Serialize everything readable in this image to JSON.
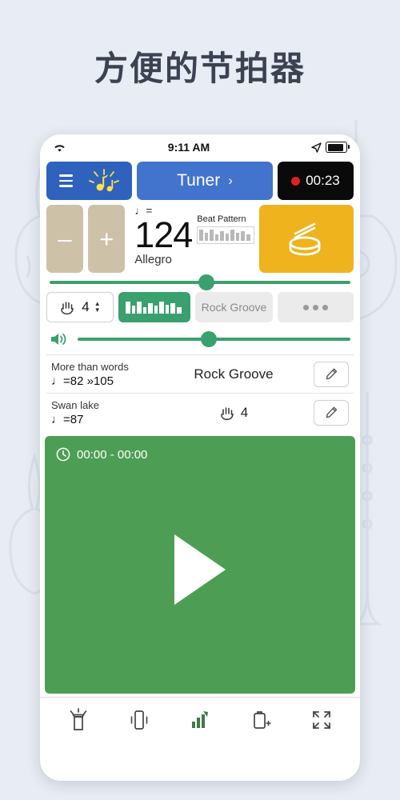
{
  "headline": "方便的节拍器",
  "status_bar": {
    "wifi_icon": "wifi-icon",
    "time": "9:11 AM",
    "location_icon": "location-arrow-icon",
    "battery_icon": "battery-full-icon"
  },
  "top_row": {
    "menu_button": {
      "name": "menu-button",
      "icon": "hamburger-icon",
      "secondary_icon": "metronome-icon"
    },
    "tuner_button": {
      "label": "Tuner",
      "chevron": "›"
    },
    "record_button": {
      "label": "00:23",
      "dot": "record-dot-icon"
    }
  },
  "tempo": {
    "minus_label": "–",
    "plus_label": "+",
    "note_eq": "♩=",
    "bpm": "124",
    "tempo_word": "Allegro",
    "beat_pattern_label": "Beat Pattern",
    "drum_icon": "drum-icon"
  },
  "tempo_slider": {
    "value_percent": 52
  },
  "volume_slider": {
    "icon": "speaker-volume-icon",
    "value_percent": 48
  },
  "pattern_row": {
    "beats_box": {
      "icon": "hand-icon",
      "value": "4",
      "stepper": "▲▼"
    },
    "pattern_strip": "pattern-strip-icon",
    "groove_button": "Rock Groove",
    "more_button": "•••"
  },
  "song_list": [
    {
      "title": "More than words",
      "tempo": "♩=82 »105",
      "middle": "Rock Groove",
      "middle_icon": "",
      "edit_icon": "pencil-icon"
    },
    {
      "title": "Swan lake",
      "tempo": "♩=87",
      "middle": "4",
      "middle_icon": "hand-icon",
      "edit_icon": "pencil-icon"
    }
  ],
  "player": {
    "clock_icon": "clock-icon",
    "time_range": "00:00 - 00:00",
    "play_icon": "play-triangle-icon",
    "background_color": "#4d9e54"
  },
  "bottom_bar": [
    {
      "name": "flashlight-icon"
    },
    {
      "name": "vibrate-icon"
    },
    {
      "name": "chart-icon"
    },
    {
      "name": "battery-plus-icon"
    },
    {
      "name": "fullscreen-icon"
    }
  ],
  "colors": {
    "blue_dark": "#2e62bd",
    "blue": "#4273cd",
    "black": "#0a0a0a",
    "tan": "#cdc1a8",
    "yellow": "#eeb31d",
    "green": "#3aa06d",
    "player_green": "#4d9e54",
    "page_bg": "#e8ecf4"
  }
}
